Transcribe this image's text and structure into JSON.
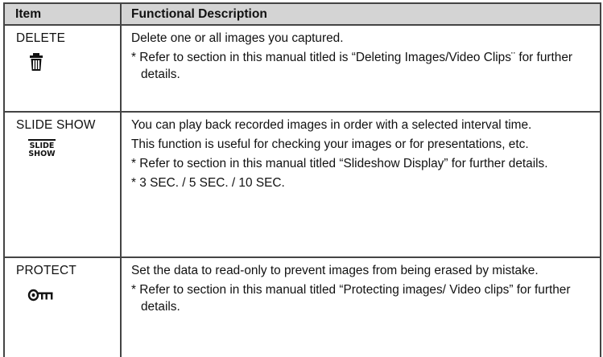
{
  "table": {
    "headers": {
      "item": "Item",
      "description": "Functional Description"
    },
    "rows": [
      {
        "item": "DELETE",
        "icon": "trash-can-icon",
        "lines": [
          "Delete one or all images you captured.",
          "* Refer to section in this manual titled is “Deleting Images/Video Clips¨ for further details."
        ]
      },
      {
        "item": "SLIDE SHOW",
        "icon": "slide-show-icon",
        "icon_text": [
          "SLIDE",
          "SHOW"
        ],
        "lines": [
          "You can play back recorded images in order with a selected interval time.",
          "This function is useful for checking your images or for presentations, etc.",
          "* Refer to section in this manual titled “Slideshow Display” for further details.",
          "* 3 SEC. / 5 SEC. / 10 SEC."
        ]
      },
      {
        "item": "PROTECT",
        "icon": "key-icon",
        "lines": [
          "Set the data to read-only to prevent images from being erased by mistake.",
          "* Refer to section in this manual titled “Protecting images/ Video clips” for further details."
        ]
      }
    ]
  }
}
